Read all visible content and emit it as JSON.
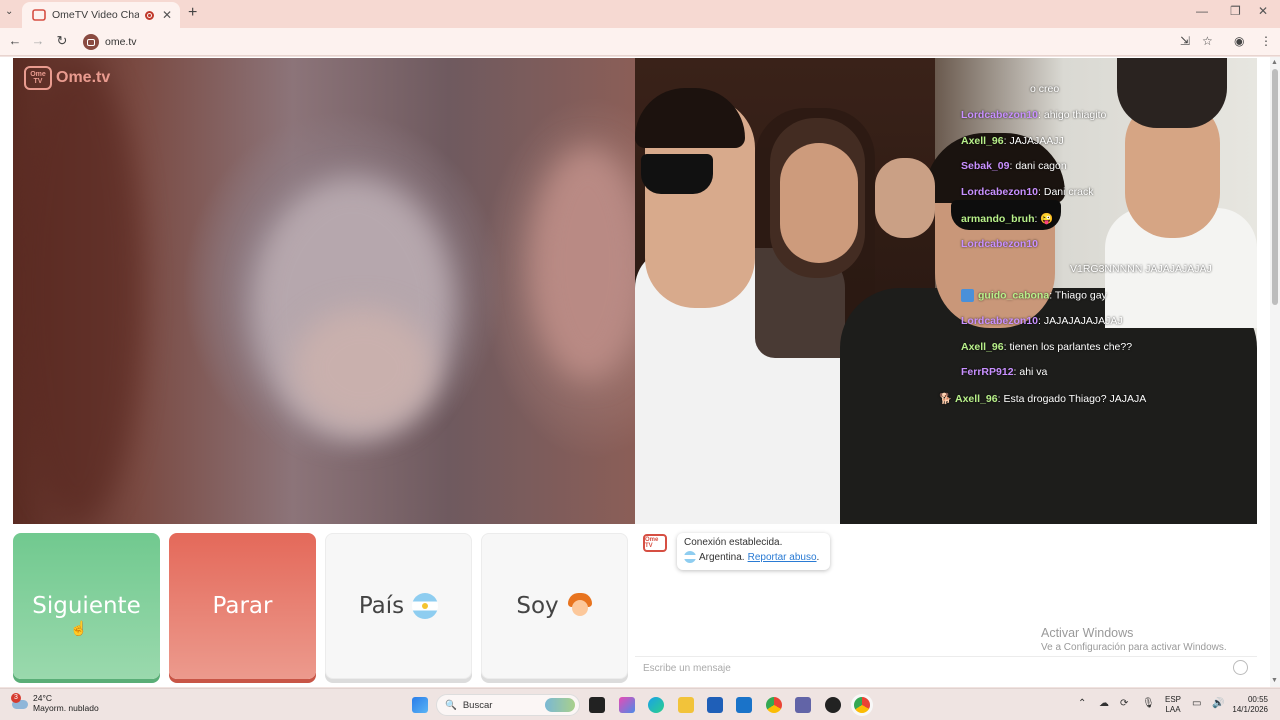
{
  "browser": {
    "tab_title": "OmeTV Video Chat — Omegle",
    "url": "ome.tv"
  },
  "site": {
    "logo_badge": "Ome TV",
    "logo_text": "Ome.tv"
  },
  "stream_chat": [
    {
      "user": "",
      "text": "o creo",
      "color": "#ffffff"
    },
    {
      "user": "Lordcabezon10",
      "text": "ahigo thiagito",
      "color": "#c890ff"
    },
    {
      "user": "Axell_96",
      "text": "JAJAJAAJJ",
      "color": "#b8f08a"
    },
    {
      "user": "Sebak_09",
      "text": "dani cagon",
      "color": "#c890ff"
    },
    {
      "user": "Lordcabezon10",
      "text": "Dani crack",
      "color": "#c890ff"
    },
    {
      "user": "armando_bruh",
      "text": "😜",
      "color": "#b8f08a"
    },
    {
      "user": "Lordcabezon10",
      "text": "",
      "color": "#c890ff"
    },
    {
      "user": "",
      "text": "V1RG3NNNNN JAJAJAJAJAJ",
      "color": "#ffffff"
    },
    {
      "user": "guido_cabona",
      "text": "Thiago gay",
      "color": "#b8f08a"
    },
    {
      "user": "Lordcabezon10",
      "text": "JAJAJAJAJAJAJ",
      "color": "#c890ff"
    },
    {
      "user": "Axell_96",
      "text": "tienen los parlantes che??",
      "color": "#b8f08a"
    },
    {
      "user": "FerrRP912",
      "text": "ahi va",
      "color": "#c890ff"
    },
    {
      "user": "Axell_96",
      "text": "Esta drogado Thiago? JAJAJA",
      "color": "#b8f08a"
    }
  ],
  "controls": {
    "next_label": "Siguiente",
    "stop_label": "Parar",
    "country_label": "País",
    "gender_label": "Soy"
  },
  "chat": {
    "system_badge": "Ome TV",
    "connected_text": "Conexión establecida.",
    "country_text": "Argentina.",
    "report_link": "Reportar abuso",
    "report_suffix": ".",
    "input_placeholder": "Escribe un mensaje"
  },
  "watermark": {
    "line1": "Activar Windows",
    "line2": "Ve a Configuración para activar Windows."
  },
  "taskbar": {
    "weather_temp": "24°C",
    "weather_desc": "Mayorm. nublado",
    "weather_badge": "3",
    "search_label": "Buscar",
    "lang_top": "ESP",
    "lang_bottom": "LAA",
    "time": "00:55",
    "date": "14/1/2026"
  },
  "colors": {
    "next_button": "#7ccd98",
    "stop_button": "#e67868",
    "brand": "#e99b8f"
  }
}
